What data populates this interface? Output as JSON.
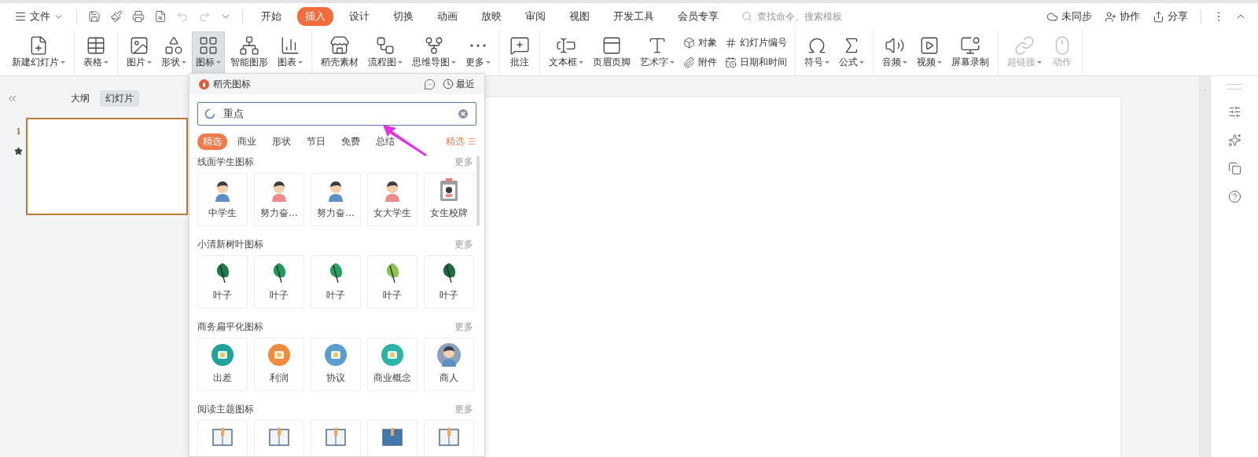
{
  "file_menu": {
    "label": "文件"
  },
  "menu_tabs": [
    {
      "label": "开始",
      "selected": false
    },
    {
      "label": "插入",
      "selected": true
    },
    {
      "label": "设计",
      "selected": false
    },
    {
      "label": "切换",
      "selected": false
    },
    {
      "label": "动画",
      "selected": false
    },
    {
      "label": "放映",
      "selected": false
    },
    {
      "label": "审阅",
      "selected": false
    },
    {
      "label": "视图",
      "selected": false
    },
    {
      "label": "开发工具",
      "selected": false
    },
    {
      "label": "会员专享",
      "selected": false
    }
  ],
  "command_search": {
    "placeholder": "查找命令、搜索模板"
  },
  "account_actions": [
    {
      "label": "未同步"
    },
    {
      "label": "协作"
    },
    {
      "label": "分享"
    }
  ],
  "ribbon_groups": [
    {
      "items": [
        {
          "label": "新建幻灯片",
          "kind": "large",
          "dropdown": true,
          "pressed": false,
          "disabled": false
        }
      ]
    },
    {
      "items": [
        {
          "label": "表格",
          "kind": "large",
          "dropdown": true,
          "pressed": false,
          "disabled": false
        }
      ]
    },
    {
      "items": [
        {
          "label": "图片",
          "kind": "large",
          "dropdown": true,
          "pressed": false,
          "disabled": false
        },
        {
          "label": "形状",
          "kind": "large",
          "dropdown": true,
          "pressed": false,
          "disabled": false
        },
        {
          "label": "图标",
          "kind": "large",
          "dropdown": true,
          "pressed": true,
          "disabled": false
        },
        {
          "label": "智能图形",
          "kind": "large",
          "dropdown": false,
          "pressed": false,
          "disabled": false
        },
        {
          "label": "图表",
          "kind": "large",
          "dropdown": true,
          "pressed": false,
          "disabled": false
        }
      ]
    },
    {
      "items": [
        {
          "label": "稻壳素材",
          "kind": "large",
          "dropdown": false,
          "pressed": false,
          "disabled": false
        },
        {
          "label": "流程图",
          "kind": "large",
          "dropdown": true,
          "pressed": false,
          "disabled": false
        },
        {
          "label": "思维导图",
          "kind": "large",
          "dropdown": true,
          "pressed": false,
          "disabled": false
        },
        {
          "label": "更多",
          "kind": "large",
          "dropdown": true,
          "pressed": false,
          "disabled": false
        }
      ]
    },
    {
      "items": [
        {
          "label": "批注",
          "kind": "large",
          "dropdown": false,
          "pressed": false,
          "disabled": false
        }
      ]
    },
    {
      "items": [
        {
          "label": "文本框",
          "kind": "large",
          "dropdown": true,
          "pressed": false,
          "disabled": false
        },
        {
          "label": "页眉页脚",
          "kind": "large",
          "dropdown": false,
          "pressed": false,
          "disabled": false
        },
        {
          "label": "艺术字",
          "kind": "large",
          "dropdown": true,
          "pressed": false,
          "disabled": false
        },
        {
          "label": "对象",
          "kind": "small",
          "dropdown": false,
          "pressed": false,
          "disabled": false
        },
        {
          "label": "附件",
          "kind": "small",
          "dropdown": false,
          "pressed": false,
          "disabled": false
        },
        {
          "label": "幻灯片编号",
          "kind": "small",
          "dropdown": false,
          "pressed": false,
          "disabled": false
        },
        {
          "label": "日期和时间",
          "kind": "small",
          "dropdown": false,
          "pressed": false,
          "disabled": false
        }
      ]
    },
    {
      "items": [
        {
          "label": "符号",
          "kind": "large",
          "dropdown": true,
          "pressed": false,
          "disabled": false
        },
        {
          "label": "公式",
          "kind": "large",
          "dropdown": true,
          "pressed": false,
          "disabled": false
        }
      ]
    },
    {
      "items": [
        {
          "label": "音频",
          "kind": "large",
          "dropdown": true,
          "pressed": false,
          "disabled": false
        },
        {
          "label": "视频",
          "kind": "large",
          "dropdown": true,
          "pressed": false,
          "disabled": false
        },
        {
          "label": "屏幕录制",
          "kind": "large",
          "dropdown": false,
          "pressed": false,
          "disabled": false
        }
      ]
    },
    {
      "items": [
        {
          "label": "超链接",
          "kind": "large",
          "dropdown": true,
          "pressed": false,
          "disabled": true
        },
        {
          "label": "动作",
          "kind": "large",
          "dropdown": false,
          "pressed": false,
          "disabled": true
        }
      ]
    }
  ],
  "slides_panel": {
    "tabs": [
      {
        "label": "大纲",
        "selected": false
      },
      {
        "label": "幻灯片",
        "selected": true
      }
    ],
    "slides": [
      {
        "number": "1",
        "selected": true
      }
    ]
  },
  "icon_panel": {
    "title": "稻壳图标",
    "recent_label": "最近",
    "search": {
      "value": "重点",
      "loading": true
    },
    "filters": [
      {
        "label": "精选",
        "selected": true
      },
      {
        "label": "商业",
        "selected": false
      },
      {
        "label": "形状",
        "selected": false
      },
      {
        "label": "节日",
        "selected": false
      },
      {
        "label": "免费",
        "selected": false
      },
      {
        "label": "总结",
        "selected": false
      }
    ],
    "filter_menu": "精选",
    "sections": [
      {
        "title": "线面学生图标",
        "more": "更多",
        "cards": [
          {
            "kind": "person",
            "label": "中学生"
          },
          {
            "kind": "person",
            "label": "努力奋..."
          },
          {
            "kind": "person",
            "label": "努力奋..."
          },
          {
            "kind": "person",
            "label": "女大学生"
          },
          {
            "kind": "badge",
            "label": "女生校牌"
          }
        ]
      },
      {
        "title": "小清新树叶图标",
        "more": "更多",
        "cards": [
          {
            "kind": "leaf",
            "label": "叶子"
          },
          {
            "kind": "leaf",
            "label": "叶子"
          },
          {
            "kind": "leaf",
            "label": "叶子"
          },
          {
            "kind": "leaf",
            "label": "叶子"
          },
          {
            "kind": "leaf",
            "label": "叶子"
          }
        ]
      },
      {
        "title": "商务扁平化图标",
        "more": "更多",
        "cards": [
          {
            "kind": "emblem",
            "label": "出差"
          },
          {
            "kind": "emblem",
            "label": "利润"
          },
          {
            "kind": "emblem",
            "label": "协议"
          },
          {
            "kind": "emblem",
            "label": "商业概念"
          },
          {
            "kind": "person",
            "label": "商人"
          }
        ]
      },
      {
        "title": "阅读主题图标",
        "more": "更多",
        "cards": [
          {
            "kind": "book"
          },
          {
            "kind": "book"
          },
          {
            "kind": "book"
          },
          {
            "kind": "book"
          },
          {
            "kind": "book"
          }
        ]
      }
    ]
  }
}
